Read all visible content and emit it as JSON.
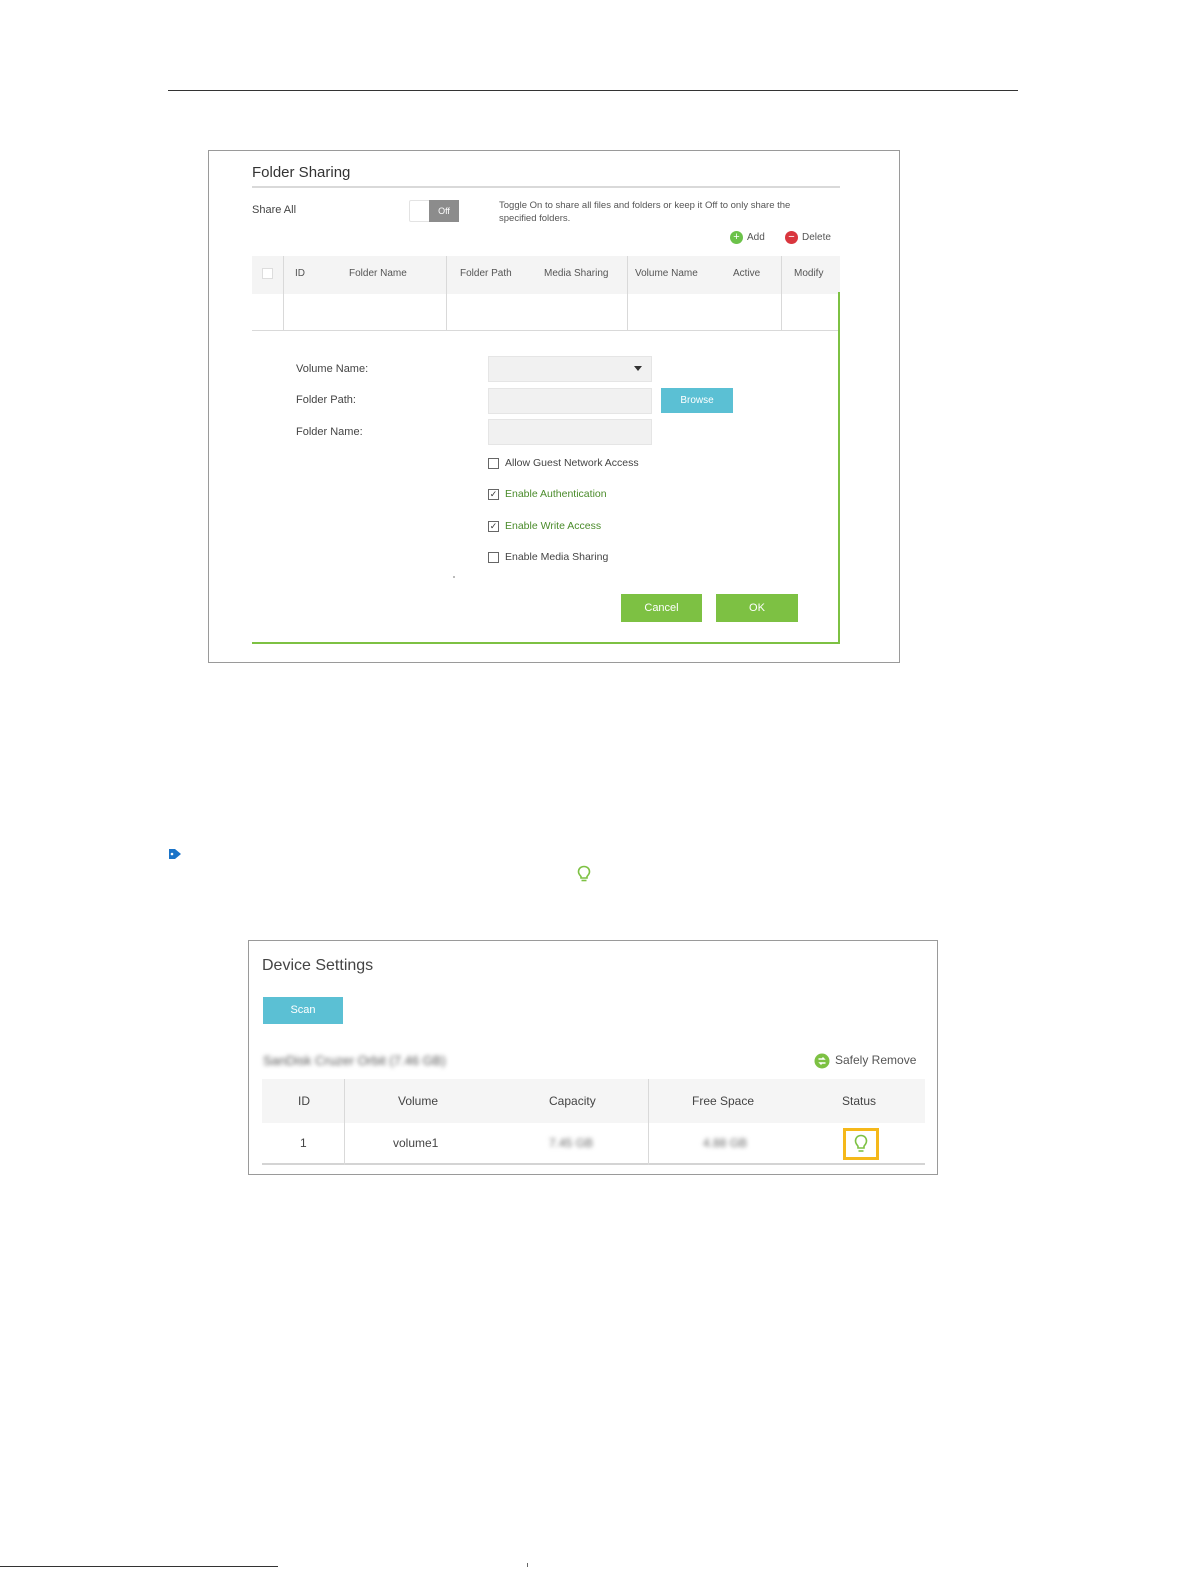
{
  "colors": {
    "accent_green": "#7dc143",
    "accent_blue": "#5bc0d4",
    "delete_red": "#d9363e",
    "highlight_yellow": "#f5b81a"
  },
  "folder_sharing": {
    "title": "Folder Sharing",
    "share_all_label": "Share All",
    "toggle_state": "Off",
    "toggle_hint": "Toggle On to share all files and folders or keep it Off to only share the specified folders.",
    "add_label": "Add",
    "delete_label": "Delete",
    "columns": [
      "ID",
      "Folder Name",
      "Folder Path",
      "Media Sharing",
      "Volume Name",
      "Active",
      "Modify"
    ],
    "form": {
      "volume_name_label": "Volume Name:",
      "folder_path_label": "Folder Path:",
      "folder_name_label": "Folder Name:",
      "browse_label": "Browse",
      "checkboxes": [
        {
          "label": "Allow Guest Network Access",
          "checked": false
        },
        {
          "label": "Enable Authentication",
          "checked": true
        },
        {
          "label": "Enable Write Access",
          "checked": true
        },
        {
          "label": "Enable Media Sharing",
          "checked": false
        }
      ],
      "cancel_label": "Cancel",
      "ok_label": "OK"
    }
  },
  "note": {
    "tag_icon": "tag-icon",
    "inline_icon": "bulb-icon"
  },
  "device_settings": {
    "title": "Device Settings",
    "scan_label": "Scan",
    "device_name": "SanDisk Cruzer Orbit (7.46 GB)",
    "safely_remove_label": "Safely Remove",
    "columns": [
      "ID",
      "Volume",
      "Capacity",
      "Free Space",
      "Status"
    ],
    "rows": [
      {
        "id": "1",
        "volume": "volume1",
        "capacity": "7.45 GB",
        "free_space": "4.88 GB",
        "status_icon": "bulb-icon"
      }
    ]
  }
}
